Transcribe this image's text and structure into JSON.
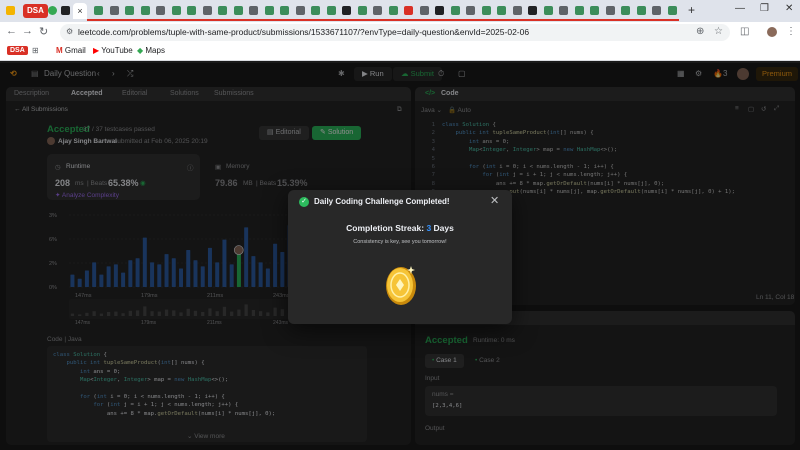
{
  "browser": {
    "tab_group_label": "DSA",
    "active_tab_close": "×",
    "new_tab": "+",
    "url": "leetcode.com/problems/tuple-with-same-product/submissions/1533671107/?envType=daily-question&envId=2025-02-06",
    "bookmarks": [
      {
        "label": "DSA"
      },
      {
        "label": "Gmail"
      },
      {
        "label": "YouTube"
      },
      {
        "label": "Maps"
      }
    ]
  },
  "header": {
    "daily_question": "Daily Question",
    "run": "Run",
    "submit": "Submit",
    "streak_count": "3",
    "premium": "Premium"
  },
  "left": {
    "tabs": [
      "Description",
      "Accepted",
      "Editorial",
      "Solutions",
      "Submissions"
    ],
    "all_submissions": "All Submissions",
    "status": "Accepted",
    "testcases": "37 / 37 testcases passed",
    "author": "Ajay Singh Bartwal",
    "submitted_at": "submitted at Feb 06, 2025 20:19",
    "editorial_btn": "Editorial",
    "solution_btn": "Solution",
    "runtime": {
      "label": "Runtime",
      "value": "208",
      "unit": "ms",
      "beats_label": "Beats",
      "beats": "65.38%",
      "analyze": "Analyze Complexity"
    },
    "memory": {
      "label": "Memory",
      "value": "79.86",
      "unit": "MB",
      "beats_label": "Beats",
      "beats": "15.39%"
    },
    "code_label": "Code",
    "code_lang": "Java",
    "view_more": "View more"
  },
  "chart_data": {
    "type": "bar",
    "yticks": [
      "3%",
      "6%",
      "2%",
      "0%"
    ],
    "xticks": [
      "147ms",
      "179ms",
      "211ms",
      "243ms",
      "275ms"
    ],
    "xticks_lower": [
      "147ms",
      "179ms",
      "211ms",
      "243ms",
      "275ms"
    ],
    "values": [
      0.6,
      0.4,
      0.8,
      1.2,
      0.6,
      1.0,
      1.1,
      0.7,
      1.3,
      1.4,
      2.4,
      1.2,
      1.1,
      1.6,
      1.4,
      0.9,
      1.8,
      1.3,
      1.0,
      1.9,
      1.2,
      2.3,
      1.1,
      1.6,
      2.9,
      1.5,
      1.2,
      0.9,
      2.1,
      1.7,
      3.0,
      1.2,
      1.6,
      2.0,
      3.3,
      2.2,
      1.5,
      2.5,
      1.8,
      0.9,
      1.1,
      0.6
    ],
    "highlight_index": 23,
    "ylim": [
      0,
      3.5
    ]
  },
  "code_panel": {
    "title": "Code",
    "lang": "Java",
    "auto": "Auto",
    "position": "Ln 11, Col 18"
  },
  "result": {
    "status": "Accepted",
    "runtime": "Runtime: 0 ms",
    "cases": [
      "Case 1",
      "Case 2"
    ],
    "input_label": "Input",
    "var_name": "nums =",
    "input_value": "[2,3,4,6]",
    "output_label": "Output"
  },
  "modal": {
    "title": "Daily Coding Challenge Completed!",
    "streak_prefix": "Completion Streak:",
    "streak_num": "3",
    "streak_suffix": "Days",
    "subtitle": "Consistency is key, see you tomorrow!"
  }
}
